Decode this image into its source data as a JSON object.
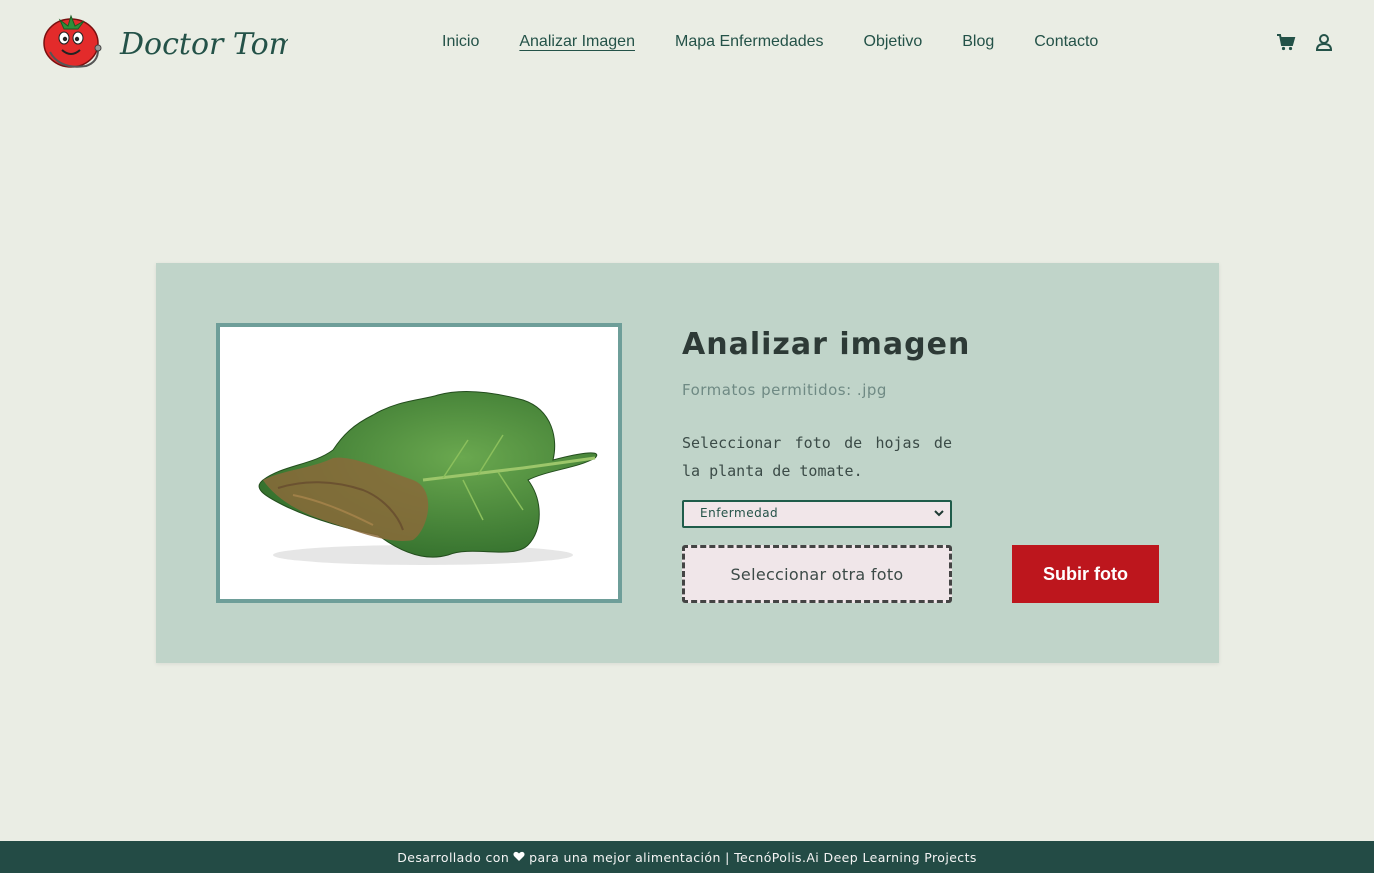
{
  "brand": {
    "name": "Doctor Tomatto"
  },
  "nav": {
    "items": [
      {
        "label": "Inicio",
        "active": false
      },
      {
        "label": "Analizar Imagen",
        "active": true
      },
      {
        "label": "Mapa Enfermedades",
        "active": false
      },
      {
        "label": "Objetivo",
        "active": false
      },
      {
        "label": "Blog",
        "active": false
      },
      {
        "label": "Contacto",
        "active": false
      }
    ],
    "icons": [
      "cart-icon",
      "user-icon"
    ]
  },
  "analyzer": {
    "title": "Analizar imagen",
    "formats": "Formatos permitidos: .jpg",
    "instructions": "Seleccionar foto de hojas de la planta de tomate.",
    "select": {
      "selected": "Enfermedad"
    },
    "file_button": "Seleccionar otra foto",
    "submit_button": "Subir foto"
  },
  "footer": {
    "before_heart": "Desarrollado con",
    "after_heart": "para una mejor alimentación | TecnóPolis.Ai Deep Learning Projects"
  },
  "colors": {
    "background": "#eaede4",
    "card": "#c0d4c9",
    "primary": "#245248",
    "accent_red": "#bd161d",
    "footer": "#234b45"
  }
}
